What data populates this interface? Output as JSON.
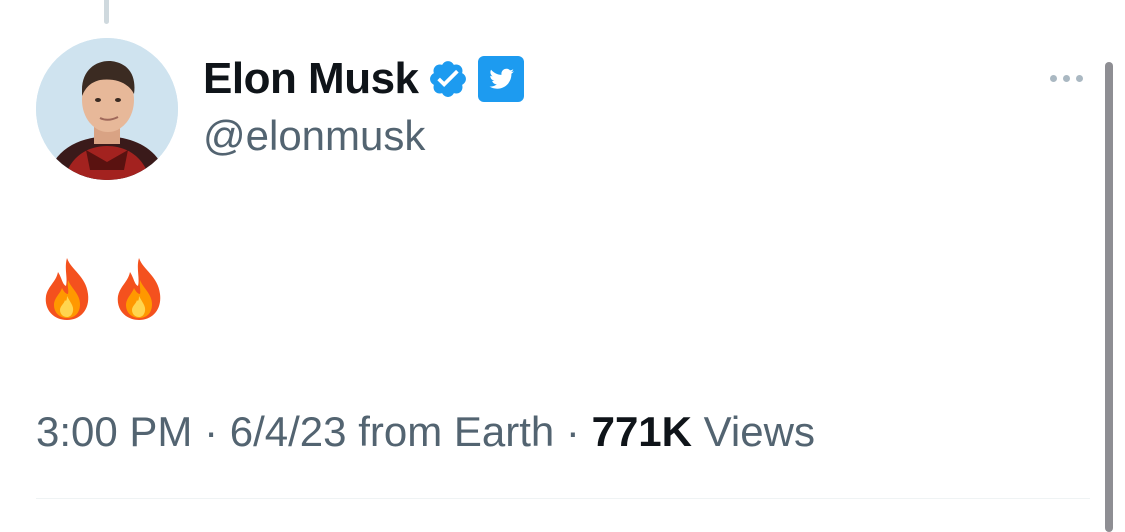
{
  "author": {
    "display_name": "Elon Musk",
    "handle": "@elonmusk",
    "verified_badge": "verified-check-icon",
    "affiliate_badge": "twitter-bird-icon",
    "avatar": "profile-photo"
  },
  "tweet": {
    "text": "🔥 🔥",
    "emoji": [
      "fire",
      "fire"
    ]
  },
  "meta": {
    "time": "3:00 PM",
    "sep1": " · ",
    "date": "6/4/23",
    "source": " from Earth",
    "sep2": " · ",
    "views_count": "771K",
    "views_label": " Views"
  },
  "colors": {
    "text_primary": "#0f1419",
    "text_secondary": "#536471",
    "verified_blue": "#1d9bf0",
    "twitter_blue": "#1d9bf0",
    "fire_red": "#f4511e",
    "fire_orange": "#ff9800"
  }
}
